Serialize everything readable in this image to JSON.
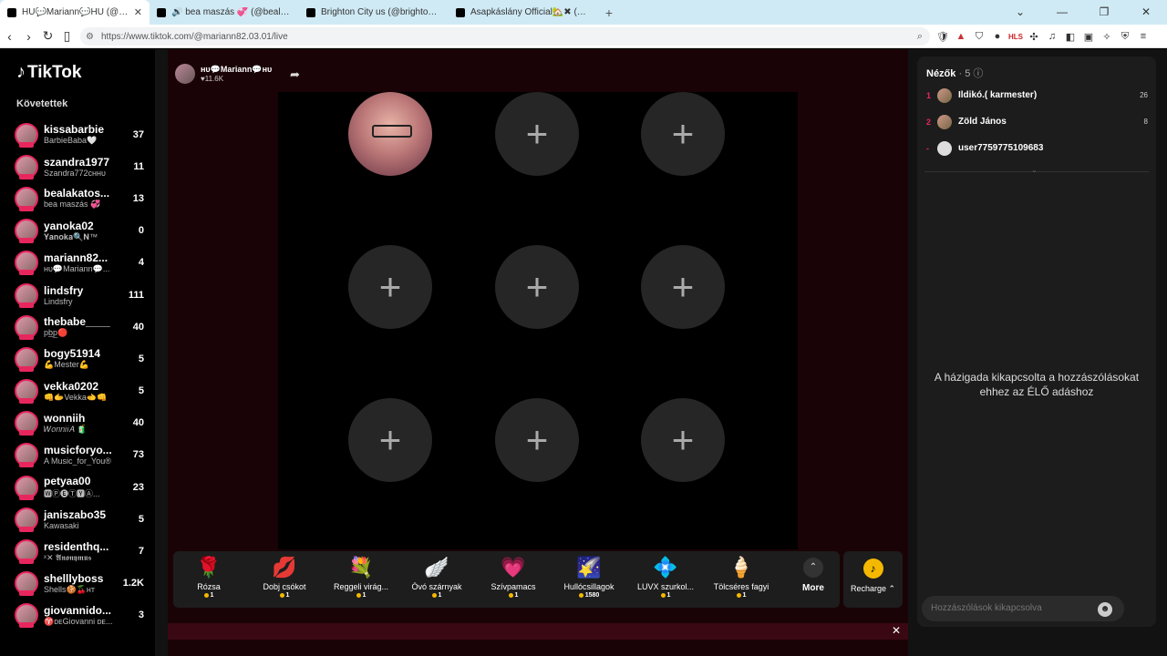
{
  "browser": {
    "tabs": [
      {
        "label": "HU💬Mariann💬HU (@mariann8",
        "active": true
      },
      {
        "label": "🔊 bea maszás 💞 (@bealakatos69",
        "active": false
      },
      {
        "label": "Brighton City us (@brighton.city) ÉLŐ",
        "active": false
      },
      {
        "label": "Asapkáslány Official🏡✖ (@theras",
        "active": false
      }
    ],
    "new_tab": "+",
    "url": "https://www.tiktok.com/@mariann82.03.01/live",
    "win_min": "⌄",
    "win_minimize": "—",
    "win_restore": "❐",
    "win_close": "✕"
  },
  "sidebar": {
    "logo": "TikTok",
    "following_title": "Követettek",
    "items": [
      {
        "name": "kissabarbie",
        "sub": "BarbieBaba🤍",
        "count": "37"
      },
      {
        "name": "szandra1977",
        "sub": "Szandra772ᴄʜʜᴜ",
        "count": "11"
      },
      {
        "name": "bealakatos...",
        "sub": "bea maszás 💞",
        "count": "13"
      },
      {
        "name": "yanoka02",
        "sub": "𝐘𝐚𝐧𝐨𝐤𝐚🔍𝐍™",
        "count": "0"
      },
      {
        "name": "mariann82...",
        "sub": "ʜᴜ💬Mariann💬...",
        "count": "4"
      },
      {
        "name": "lindsfry",
        "sub": "Lindsfry",
        "count": "111"
      },
      {
        "name": "thebabe____",
        "sub": "pb̲p̲🔴",
        "count": "40"
      },
      {
        "name": "bogy51914",
        "sub": "💪Mester💪",
        "count": "5"
      },
      {
        "name": "vekka0202",
        "sub": "👊🫱Vekka🫲👊",
        "count": "5"
      },
      {
        "name": "wonniih",
        "sub": "𝑊𝑜𝑛𝑛𝑖𝑖𝐴 🧃",
        "count": "40"
      },
      {
        "name": "musicforyo...",
        "sub": "A Music_for_You®",
        "count": "73"
      },
      {
        "name": "petyaa00",
        "sub": "🆆Ⓟ🅔Ⓣ🆈Ⓐ...",
        "count": "23"
      },
      {
        "name": "janiszabo35",
        "sub": "Kawasaki",
        "count": "5"
      },
      {
        "name": "residenthq...",
        "sub": "ˣ✕ 𝕬𝖓𝖔𝖓𝖞𝖒𝖚𝖘",
        "count": "7"
      },
      {
        "name": "shelllyboss",
        "sub": "Shells🍪🍒ʜᴛ",
        "count": "1.2K"
      },
      {
        "name": "giovannido...",
        "sub": "♈ᴅᴇGiovanni ᴅᴇ...",
        "count": "3"
      }
    ]
  },
  "host": {
    "name": "ʜᴜ💬Mariann💬ʜᴜ",
    "likes": "♥11.6K"
  },
  "slot_plus": "+",
  "gifts": [
    {
      "icon": "🌹",
      "name": "Rózsa",
      "price": "1"
    },
    {
      "icon": "💋",
      "name": "Dobj csókot",
      "price": "1"
    },
    {
      "icon": "💐",
      "name": "Reggeli virág...",
      "price": "1"
    },
    {
      "icon": "🪽",
      "name": "Óvó szárnyak",
      "price": "1"
    },
    {
      "icon": "💗",
      "name": "Szívpamacs",
      "price": "1"
    },
    {
      "icon": "🌠",
      "name": "Hullócsillagok",
      "price": "1580"
    },
    {
      "icon": "💠",
      "name": "LUVX szurkol...",
      "price": "1"
    },
    {
      "icon": "🍦",
      "name": "Tölcséres fagyi",
      "price": "1"
    }
  ],
  "more_label": "More",
  "more_icon": "⌃",
  "recharge_label": "Recharge ⌃",
  "recharge_icon": "♪",
  "bottom_close": "✕",
  "viewers": {
    "title": "Nézők",
    "count": "· 5",
    "help": "ⓘ",
    "list": [
      {
        "rank": "1",
        "name": "Ildikó.( karmester)",
        "score": "26"
      },
      {
        "rank": "2",
        "name": "Zöld János",
        "score": "8"
      },
      {
        "rank": "-",
        "name": "user7759775109683",
        "score": ""
      }
    ]
  },
  "chat": {
    "disabled_message": "A házigada kikapcsolta a hozzászólásokat ehhez az ÉLŐ adáshoz",
    "input_placeholder": "Hozzászólások kikapcsolva",
    "emoji": "☻",
    "chevron": "⌄"
  }
}
